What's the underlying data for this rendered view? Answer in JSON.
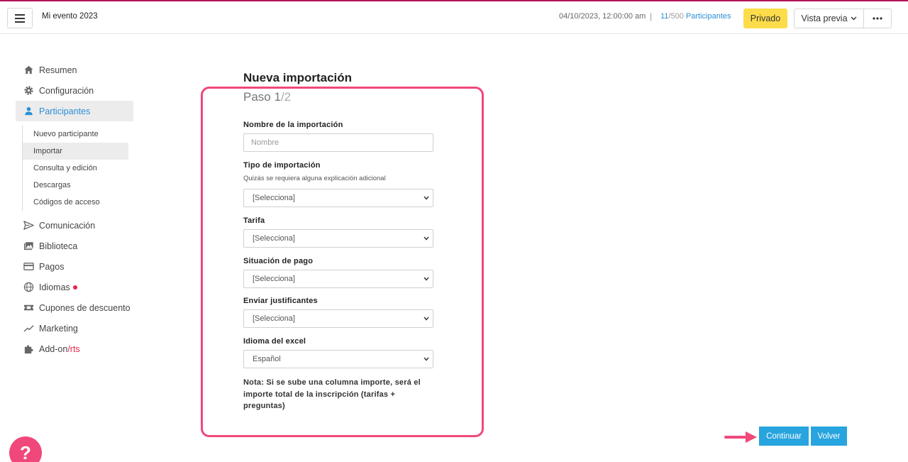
{
  "header": {
    "event_name": "Mi evento 2023",
    "event_date": "04/10/2023, 12:00:00 am",
    "separator": "|",
    "count_current": "11",
    "count_total": "/500",
    "count_label": " Participantes",
    "private_label": "Privado",
    "preview_label": "Vista previa"
  },
  "sidebar": {
    "items": [
      {
        "label": "Resumen",
        "icon": "home-icon"
      },
      {
        "label": "Configuración",
        "icon": "gear-icon"
      },
      {
        "label": "Participantes",
        "icon": "user-icon"
      },
      {
        "label": "Comunicación",
        "icon": "send-icon"
      },
      {
        "label": "Biblioteca",
        "icon": "images-icon"
      },
      {
        "label": "Pagos",
        "icon": "credit-card-icon"
      },
      {
        "label": "Idiomas",
        "icon": "globe-icon"
      },
      {
        "label": "Cupones de descuento",
        "icon": "ticket-icon"
      },
      {
        "label": "Marketing",
        "icon": "chart-line-icon"
      },
      {
        "label": "Add-on",
        "suffix": "/rts",
        "icon": "puzzle-icon"
      }
    ],
    "sub_items": [
      {
        "label": "Nuevo participante"
      },
      {
        "label": "Importar"
      },
      {
        "label": "Consulta y edición"
      },
      {
        "label": "Descargas"
      },
      {
        "label": "Códigos de acceso"
      }
    ]
  },
  "form": {
    "title": "Nueva importación",
    "step_label": "Paso 1",
    "step_total": "/2",
    "name_label": "Nombre de la importación",
    "name_placeholder": "Nombre",
    "type_label": "Tipo de importación",
    "type_help": "Quizás se requiera alguna explicación adicional",
    "type_value": "[Selecciona]",
    "rate_label": "Tarifa",
    "rate_value": "[Selecciona]",
    "payment_label": "Situación de pago",
    "payment_value": "[Selecciona]",
    "receipts_label": "Enviar justificantes",
    "receipts_value": "[Selecciona]",
    "language_label": "Idioma del excel",
    "language_value": "Español",
    "note": "Nota: Si se sube una columna importe, será el importe total de la inscripción (tarifas + preguntas)"
  },
  "actions": {
    "continue_label": "Continuar",
    "back_label": "Volver"
  },
  "help": {
    "label": "?"
  },
  "colors": {
    "accent": "#2a8fd6",
    "highlight": "#f0487a",
    "private": "#fddc4a",
    "button": "#28a4de"
  }
}
